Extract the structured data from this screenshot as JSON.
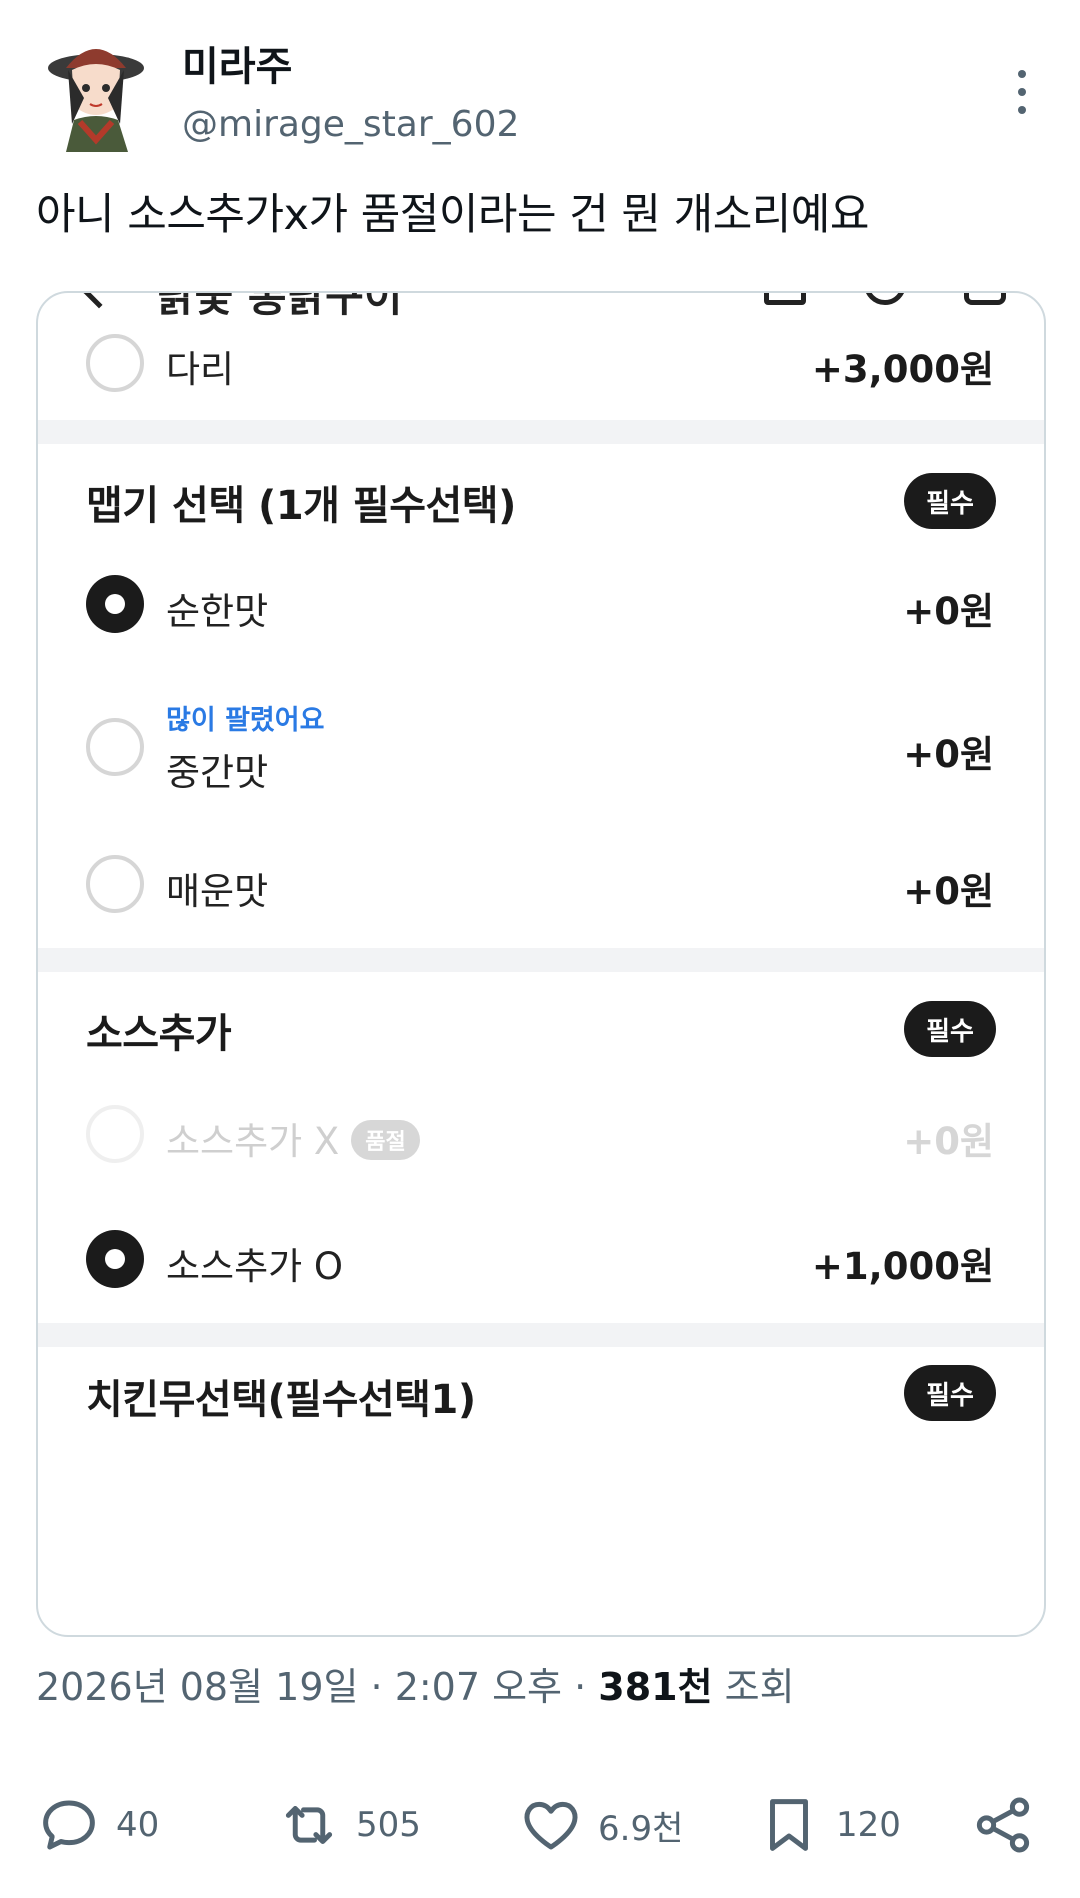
{
  "tweet": {
    "display_name": "미라주",
    "handle": "@mirage_star_602",
    "text": "아니 소스추가x가 품절이라는 건 뭔 개소리예요",
    "more_icon": "more-dots-icon"
  },
  "screenshot": {
    "top_bar_title_cut": "닭꽃 통닭구이",
    "top_option": {
      "label": "다리",
      "price": "+3,000원",
      "selected": false
    },
    "spice_section": {
      "title": "맵기 선택 (1개 필수선택)",
      "badge": "필수",
      "options": [
        {
          "label": "순한맛",
          "price": "+0원",
          "selected": true
        },
        {
          "hint": "많이 팔렸어요",
          "label": "중간맛",
          "price": "+0원",
          "selected": false
        },
        {
          "label": "매운맛",
          "price": "+0원",
          "selected": false
        }
      ]
    },
    "sauce_section": {
      "title": "소스추가",
      "badge": "필수",
      "options": [
        {
          "label": "소스추가 X",
          "tag": "품절",
          "price": "+0원",
          "selected": false,
          "disabled": true
        },
        {
          "label": "소스추가 O",
          "price": "+1,000원",
          "selected": true
        }
      ]
    },
    "radish_section": {
      "title": "치킨무선택(필수선택1)",
      "badge": "필수"
    }
  },
  "meta": {
    "datetime": "2026년 08월 19일 · 2:07 오후 · ",
    "views_count": "381천",
    "views_label": " 조회"
  },
  "actions": {
    "replies": "40",
    "retweets": "505",
    "likes": "6.9천",
    "bookmarks": "120"
  },
  "colors": {
    "text_primary": "#0f1419",
    "text_secondary": "#536471",
    "hint_blue": "#2a7ae4",
    "badge_black": "#1b1b1b",
    "separator": "#f2f3f5"
  }
}
